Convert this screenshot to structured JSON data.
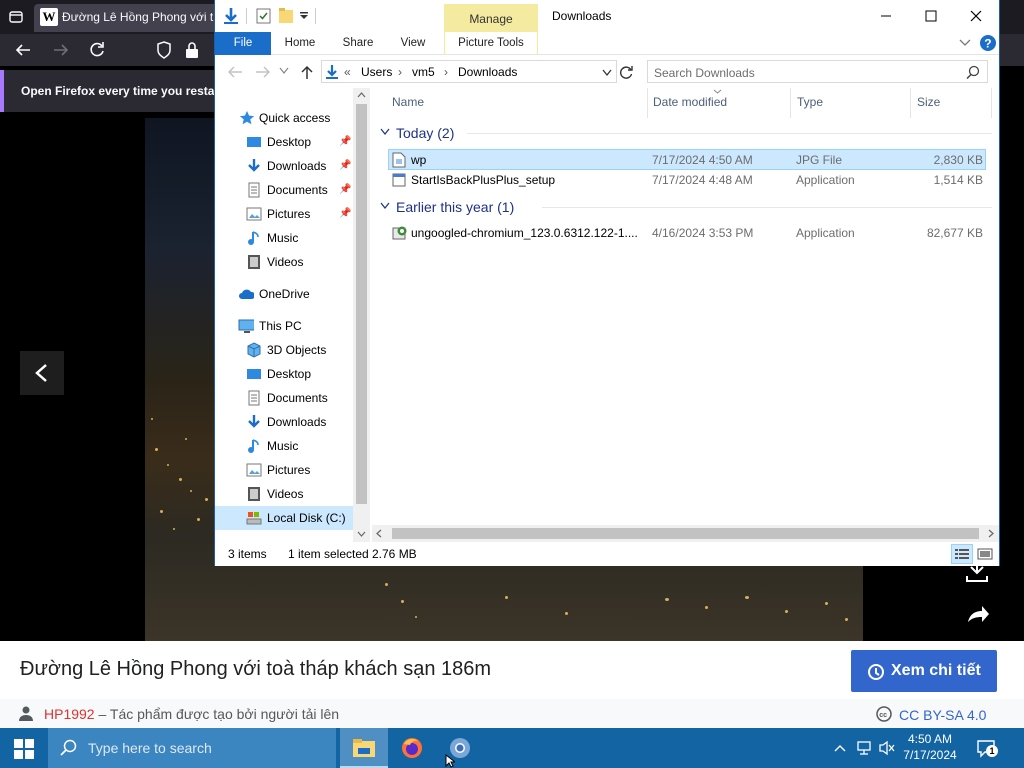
{
  "firefox": {
    "tab_title": "Đường Lê Hồng Phong với t",
    "notice_text": "Open Firefox every time you resta"
  },
  "viewer": {
    "caption": "Đường Lê Hồng Phong với toà tháp khách sạn 186m",
    "detail_button": "Xem chi tiết",
    "author": "HP1992",
    "author_suffix": "– Tác phẩm được tạo bởi người tải lên",
    "license": "CC BY-SA 4.0"
  },
  "explorer": {
    "manage_tab": "Manage",
    "window_title": "Downloads",
    "ribbon_tabs": [
      "File",
      "Home",
      "Share",
      "View",
      "Picture Tools"
    ],
    "breadcrumb": [
      "Users",
      "vm5",
      "Downloads"
    ],
    "search_placeholder": "Search Downloads",
    "nav": {
      "quick_access": "Quick access",
      "qa_items": [
        "Desktop",
        "Downloads",
        "Documents",
        "Pictures",
        "Music",
        "Videos"
      ],
      "onedrive": "OneDrive",
      "this_pc": "This PC",
      "pc_items": [
        "3D Objects",
        "Desktop",
        "Documents",
        "Downloads",
        "Music",
        "Pictures",
        "Videos",
        "Local Disk (C:)"
      ]
    },
    "columns": [
      "Name",
      "Date modified",
      "Type",
      "Size"
    ],
    "groups": [
      {
        "label": "Today (2)",
        "files": [
          {
            "name": "wp",
            "date": "7/17/2024 4:50 AM",
            "type": "JPG File",
            "size": "2,830 KB",
            "selected": true
          },
          {
            "name": "StartIsBackPlusPlus_setup",
            "date": "7/17/2024 4:48 AM",
            "type": "Application",
            "size": "1,514 KB",
            "selected": false
          }
        ]
      },
      {
        "label": "Earlier this year (1)",
        "files": [
          {
            "name": "ungoogled-chromium_123.0.6312.122-1....",
            "date": "4/16/2024 3:53 PM",
            "type": "Application",
            "size": "82,677 KB",
            "selected": false
          }
        ]
      }
    ],
    "status": {
      "item_count": "3 items",
      "selection": "1 item selected",
      "selection_size": "2.76 MB"
    }
  },
  "taskbar": {
    "search_placeholder": "Type here to search",
    "time": "4:50 AM",
    "date": "7/17/2024",
    "notification_count": "1"
  }
}
